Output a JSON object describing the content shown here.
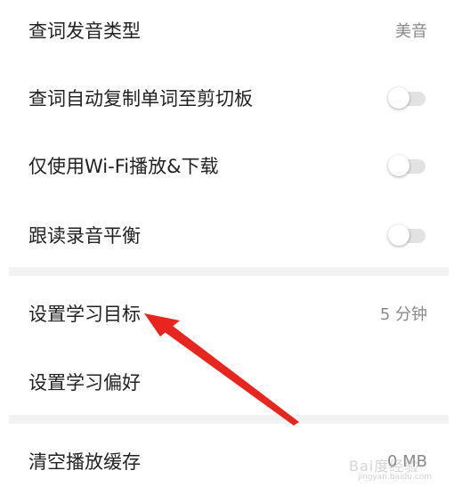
{
  "settings": {
    "lookup_pronunciation": {
      "label": "查词发音类型",
      "value": "美音"
    },
    "auto_copy": {
      "label": "查词自动复制单词至剪切板",
      "enabled": false
    },
    "wifi_only": {
      "label": "仅使用Wi-Fi播放&下载",
      "enabled": false
    },
    "readalong_balance": {
      "label": "跟读录音平衡",
      "enabled": false
    },
    "study_goal": {
      "label": "设置学习目标",
      "value": "5 分钟"
    },
    "study_preference": {
      "label": "设置学习偏好"
    },
    "clear_cache": {
      "label": "清空播放缓存",
      "value": "0 MB"
    }
  },
  "watermark": {
    "text": "Bai度经验",
    "url": "jingyan.baidu.com"
  },
  "colors": {
    "arrow": "#e8261f",
    "toggle_off": "#e2e2e2",
    "divider": "#f2f2f2"
  }
}
